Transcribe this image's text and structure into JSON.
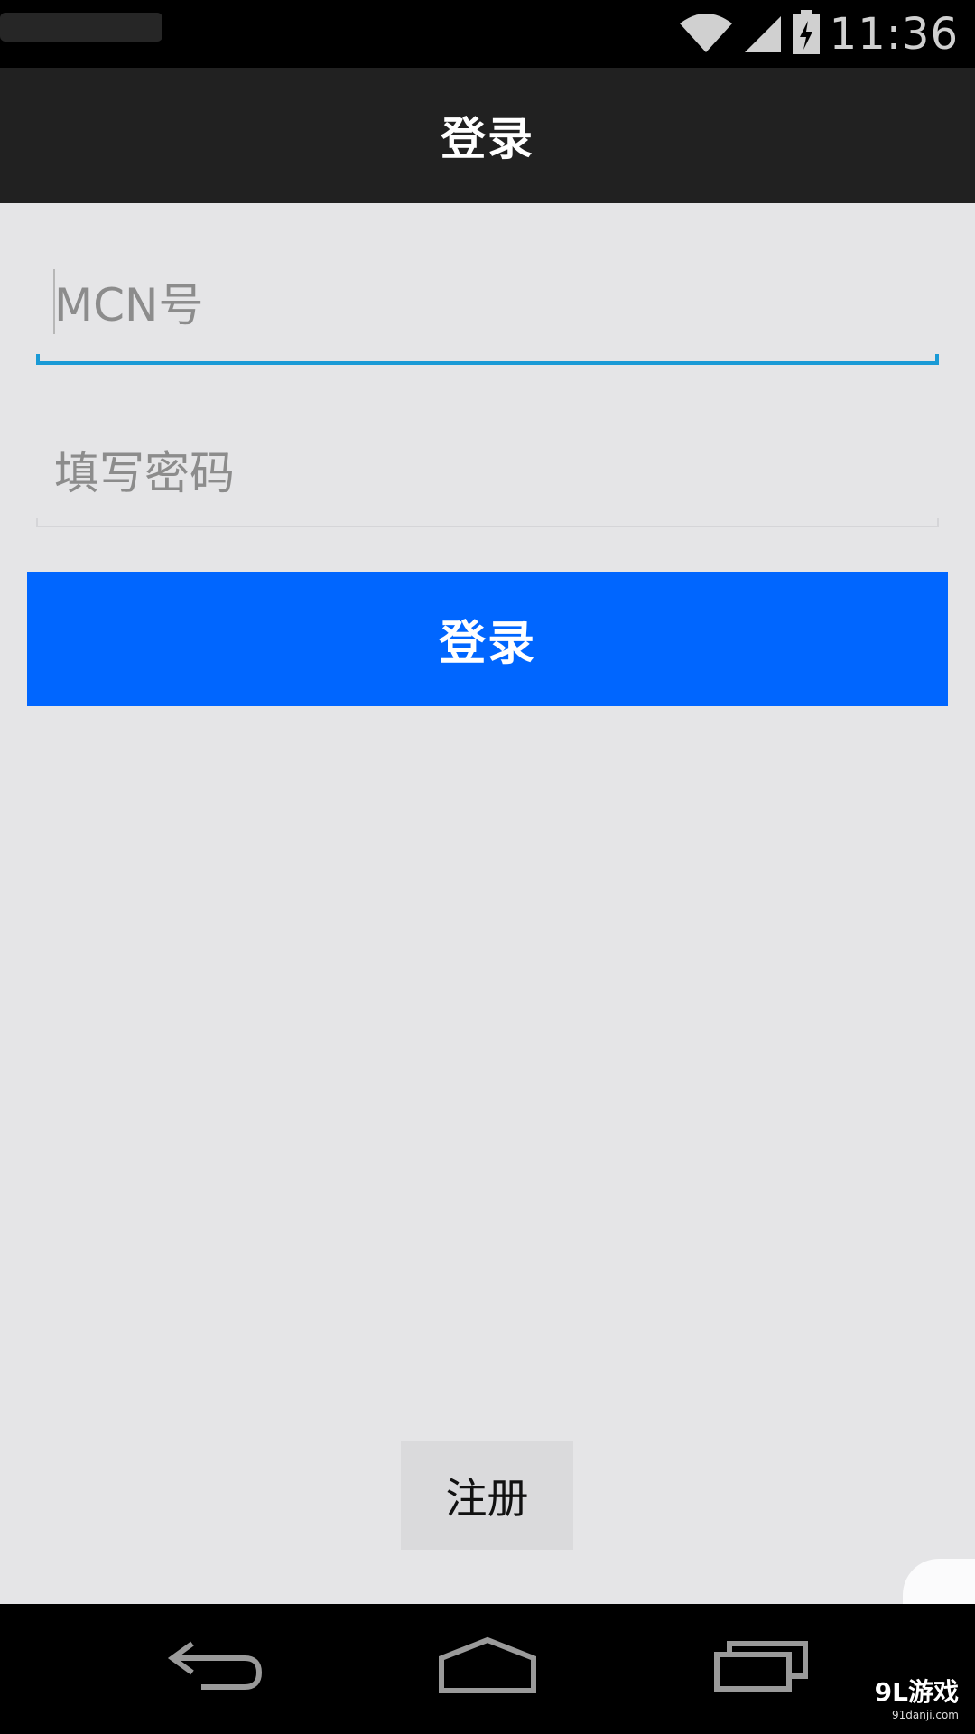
{
  "status_bar": {
    "time": "11:36",
    "icons": [
      "wifi-icon",
      "signal-icon",
      "battery-charging-icon"
    ]
  },
  "header": {
    "title": "登录"
  },
  "form": {
    "account_placeholder": "MCN号",
    "account_value": "",
    "password_placeholder": "填写密码",
    "password_value": "",
    "login_label": "登录"
  },
  "footer": {
    "register_label": "注册"
  },
  "nav_bar": {
    "icons": [
      "back-icon",
      "home-icon",
      "recent-apps-icon"
    ]
  },
  "watermark": {
    "main": "9L游戏",
    "sub": "91danji.com"
  },
  "colors": {
    "title_bar": "#212121",
    "background": "#e5e5e7",
    "login_button": "#0066ff",
    "active_underline": "#1a9ad6"
  }
}
